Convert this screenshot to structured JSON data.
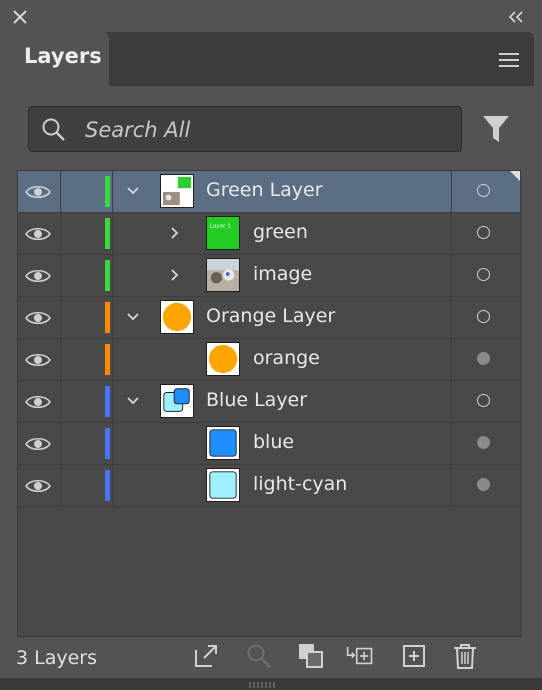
{
  "panel": {
    "tab_label": "Layers",
    "layer_count": "3 Layers"
  },
  "search": {
    "placeholder": "Search All"
  },
  "layers": [
    {
      "name": "Green Layer",
      "color": "#3bdb3b",
      "level": 0,
      "expanded": true,
      "selected": true,
      "thumb": "green-layer",
      "target": "hollow"
    },
    {
      "name": "green",
      "color": "#3bdb3b",
      "level": 1,
      "expanded": false,
      "has_children": true,
      "thumb": "green",
      "target": "hollow"
    },
    {
      "name": "image",
      "color": "#3bdb3b",
      "level": 1,
      "expanded": false,
      "has_children": true,
      "thumb": "image",
      "target": "hollow"
    },
    {
      "name": "Orange Layer",
      "color": "#ff8a00",
      "level": 0,
      "expanded": true,
      "thumb": "orange-layer",
      "target": "hollow"
    },
    {
      "name": "orange",
      "color": "#ff8a00",
      "level": 1,
      "has_children": false,
      "thumb": "orange",
      "target": "filled"
    },
    {
      "name": "Blue Layer",
      "color": "#4a73ff",
      "level": 0,
      "expanded": true,
      "thumb": "blue-layer",
      "target": "hollow"
    },
    {
      "name": "blue",
      "color": "#4a73ff",
      "level": 1,
      "has_children": false,
      "thumb": "blue",
      "target": "filled"
    },
    {
      "name": "light-cyan",
      "color": "#4a73ff",
      "level": 1,
      "has_children": false,
      "thumb": "light-cyan",
      "target": "filled"
    }
  ],
  "thumb_text": {
    "green": "Layer 1"
  },
  "icons": [
    "close-icon",
    "collapse-icon",
    "menu-icon",
    "search-icon",
    "filter-icon",
    "eye-icon",
    "chevron-icon",
    "export-icon",
    "locate-object-icon",
    "clipping-mask-icon",
    "move-to-layer-icon",
    "new-layer-icon",
    "delete-icon"
  ]
}
